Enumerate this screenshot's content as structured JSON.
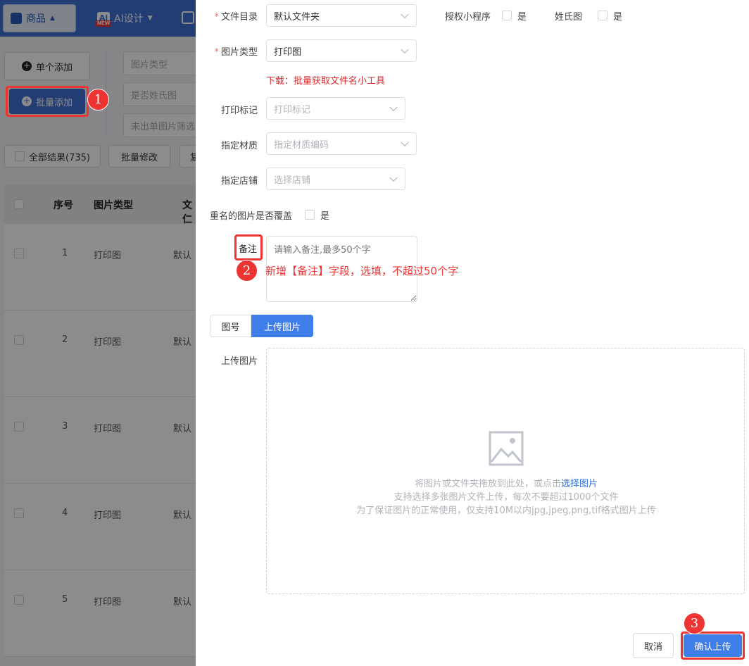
{
  "nav": {
    "goods_label": "商品",
    "ai_label": "AI设计",
    "ai_new_badge": "NEW"
  },
  "toolbar": {
    "single_add": "单个添加",
    "batch_add": "批量添加",
    "filter_image_type_placeholder": "图片类型",
    "filter_surname_placeholder": "是否姓氏图",
    "filter_not_ordered_placeholder": "未出单图片筛选",
    "all_results": "全部结果(735)",
    "batch_edit": "批量修改",
    "copy_partial": "复"
  },
  "table": {
    "headers": {
      "index": "序号",
      "image_type": "图片类型",
      "folder_partial": "文仁"
    },
    "rows": [
      {
        "index": "1",
        "image_type": "打印图",
        "folder": "默认"
      },
      {
        "index": "2",
        "image_type": "打印图",
        "folder": "默认"
      },
      {
        "index": "3",
        "image_type": "打印图",
        "folder": "默认"
      },
      {
        "index": "4",
        "image_type": "打印图",
        "folder": "默认"
      },
      {
        "index": "5",
        "image_type": "打印图",
        "folder": "默认"
      }
    ]
  },
  "form": {
    "folder_label": "文件目录",
    "folder_value": "默认文件夹",
    "mini_program_label": "授权小程序",
    "mini_program_yes": "是",
    "surname_label": "姓氏图",
    "surname_yes": "是",
    "image_type_label": "图片类型",
    "image_type_value": "打印图",
    "download_tool_link": "下载：批量获取文件名小工具",
    "print_mark_label": "打印标记",
    "print_mark_placeholder": "打印标记",
    "material_label": "指定材质",
    "material_placeholder": "指定材质编码",
    "shop_label": "指定店铺",
    "shop_placeholder": "选择店铺",
    "overwrite_label": "重名的图片是否覆盖",
    "overwrite_yes": "是",
    "remark_label": "备注",
    "remark_placeholder": "请输入备注,最多50个字",
    "remark_annotation": "新增【备注】字段，选填，不超过50个字",
    "tab_number": "图号",
    "tab_upload": "上传图片",
    "upload_label": "上传图片",
    "drop_text_prefix": "将图片或文件夹拖放到此处，或点击",
    "drop_select_link": "选择图片",
    "drop_hint_multi": "支持选择多张图片文件上传，每次不要超过1000个文件",
    "drop_hint_format": "为了保证图片的正常使用，仅支持10M以内jpg,jpeg,png,tif格式图片上传",
    "cancel": "取消",
    "confirm": "确认上传"
  },
  "annotations": {
    "step1": "1",
    "step2": "2",
    "step3": "3"
  },
  "colors": {
    "primary": "#3f6fd1",
    "accent_red": "#e33",
    "link_blue": "#2f6fd6",
    "download_red": "#d9272e"
  }
}
